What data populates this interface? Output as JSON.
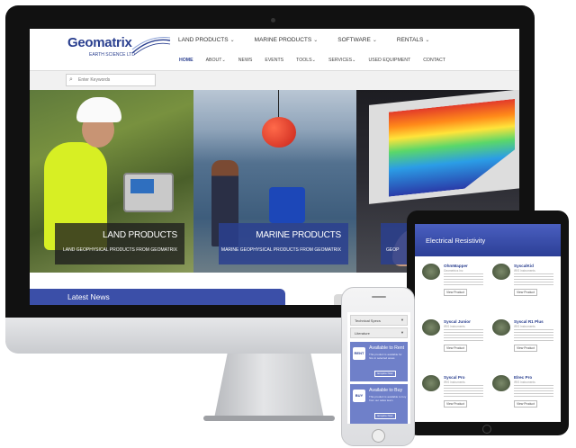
{
  "site": {
    "logo_name": "Geomatrix",
    "logo_sub": "EARTH SCIENCE LTD",
    "primary_nav": [
      "LAND PRODUCTS",
      "MARINE PRODUCTS",
      "SOFTWARE",
      "RENTALS"
    ],
    "secondary_nav": [
      "HOME",
      "ABOUT",
      "NEWS",
      "EVENTS",
      "TOOLS",
      "SERVICES",
      "USED EQUIPMENT",
      "CONTACT"
    ],
    "search_placeholder": "Enter Keywords",
    "hero": {
      "land": {
        "title": "LAND PRODUCTS",
        "sub": "LAND GEOPHYSICAL PRODUCTS FROM GEOMATRIX"
      },
      "marine": {
        "title": "MARINE PRODUCTS",
        "sub": "MARINE GEOPHYSICAL PRODUCTS FROM GEOMATRIX"
      },
      "software": {
        "sub": "GEOP"
      }
    },
    "latest_news": "Latest News",
    "colors": {
      "brand": "#2a3f8f",
      "accent": "#3b4fa8"
    }
  },
  "ipad": {
    "banner_title": "Electrical Resistivity",
    "products": [
      {
        "name": "OhmMapper",
        "meta": "Geometrics Inc",
        "button": "View Product"
      },
      {
        "name": "SyscalKid",
        "meta": "IRIS Instruments",
        "button": "View Product"
      },
      {
        "name": "Syscal Junior",
        "meta": "IRIS Instruments",
        "button": "View Product"
      },
      {
        "name": "Syscal R1 Plus",
        "meta": "IRIS Instruments",
        "button": "View Product"
      },
      {
        "name": "Syscal Pro",
        "meta": "IRIS Instruments",
        "button": "View Product"
      },
      {
        "name": "Elrec Pro",
        "meta": "IRIS Instruments",
        "button": "View Product"
      }
    ]
  },
  "iphone": {
    "accordion": [
      "Technical Specs",
      "Literature"
    ],
    "promos": [
      {
        "icon": "RENT",
        "title": "Available to Rent",
        "text": "This product is available for hire in selected areas",
        "button": "Enquire Now"
      },
      {
        "icon": "BUY",
        "title": "Available to Buy",
        "text": "This product is available to buy from our sales team",
        "button": "Enquire Now"
      }
    ]
  }
}
